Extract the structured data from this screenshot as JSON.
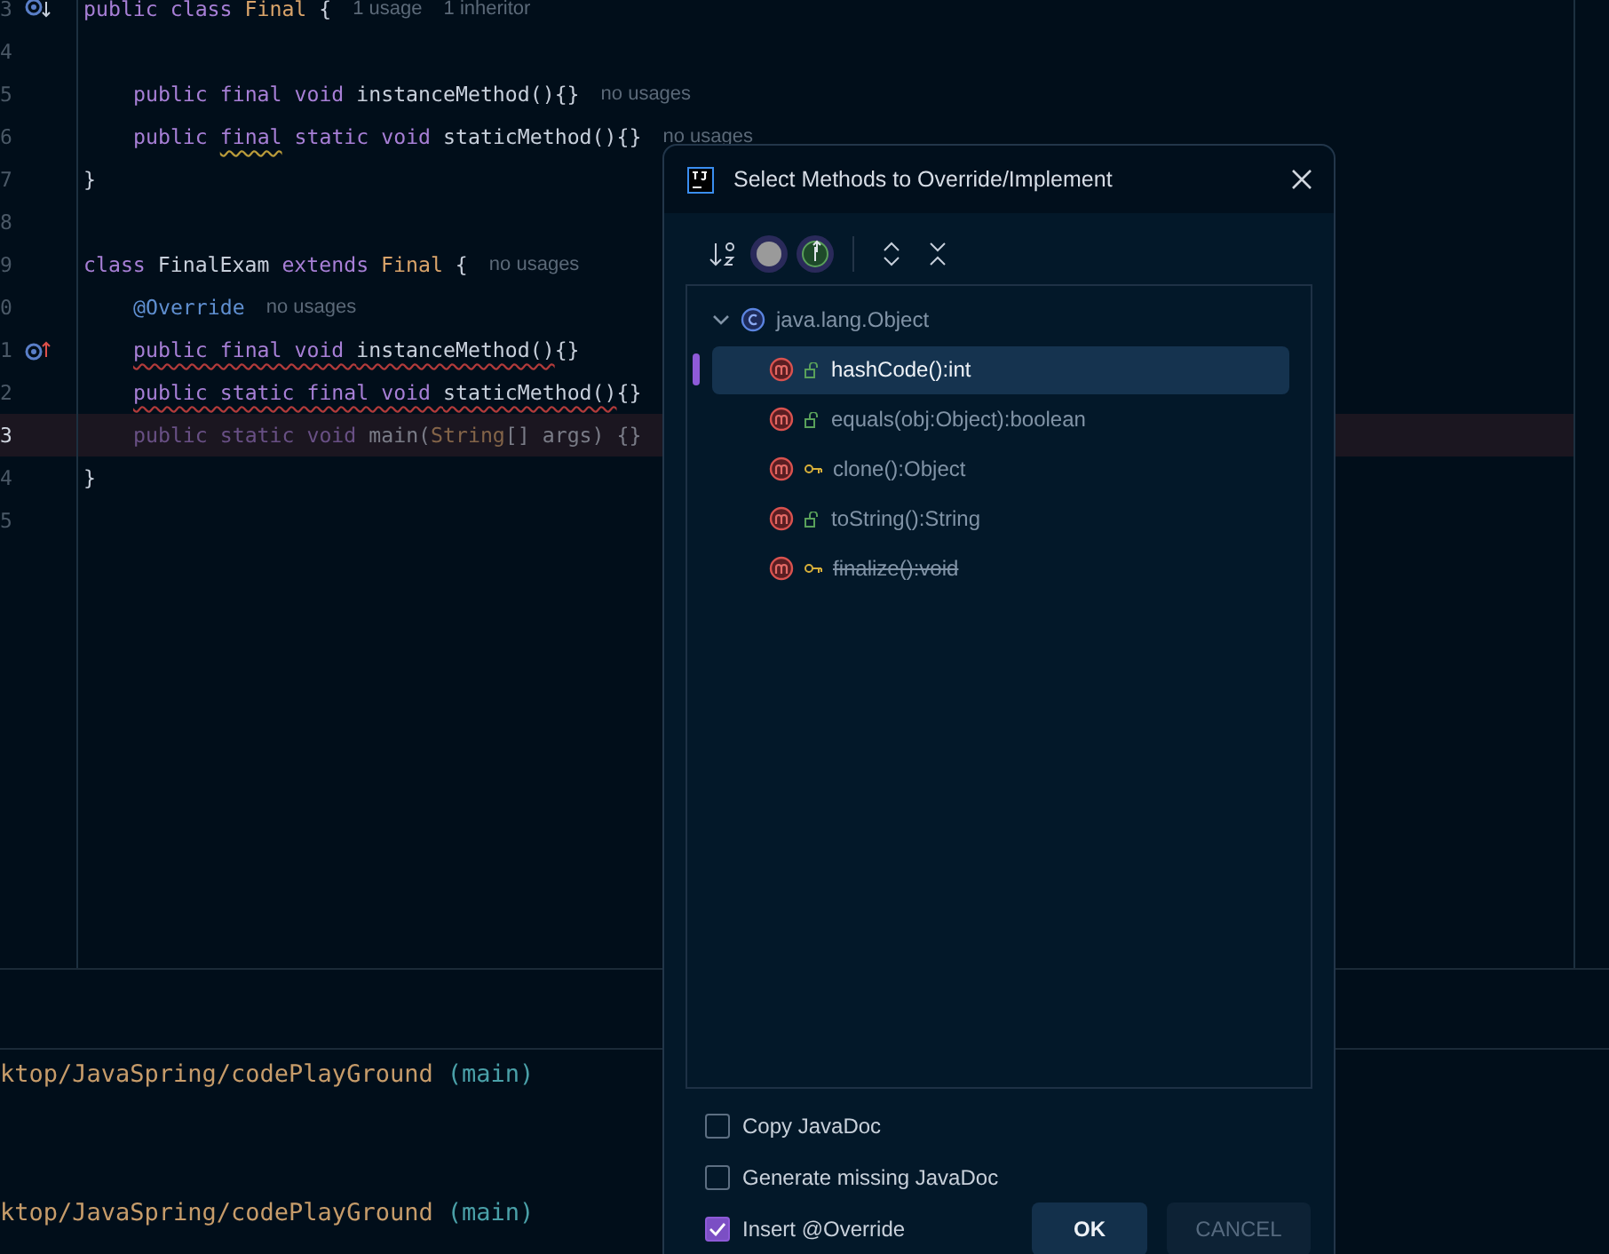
{
  "editor": {
    "lines": [
      {
        "number": "3",
        "marker": {
          "kind": "implemented"
        },
        "current": false,
        "dimmed": false,
        "indented": false,
        "tokens": [
          {
            "text": "public class ",
            "kind": "kw",
            "error": false,
            "warning": false
          },
          {
            "text": "Final",
            "kind": "cls",
            "error": false,
            "warning": false
          },
          {
            "text": " {",
            "kind": "plain",
            "error": false,
            "warning": false
          }
        ],
        "hints": [
          "1 usage",
          "1 inheritor"
        ]
      },
      {
        "number": "4",
        "current": false
      },
      {
        "number": "5",
        "current": false,
        "dimmed": false,
        "indented": true,
        "tokens": [
          {
            "text": "public final void ",
            "kind": "kw",
            "error": false,
            "warning": false
          },
          {
            "text": "instanceMethod(){}",
            "kind": "plain",
            "error": false,
            "warning": false
          }
        ],
        "hints": [
          "no usages"
        ]
      },
      {
        "number": "6",
        "current": false,
        "dimmed": false,
        "indented": true,
        "tokens": [
          {
            "text": "public ",
            "kind": "kw",
            "error": false,
            "warning": false
          },
          {
            "text": "final",
            "kind": "kw",
            "error": false,
            "warning": true
          },
          {
            "text": " static void ",
            "kind": "kw",
            "error": false,
            "warning": false
          },
          {
            "text": "staticMethod(){}",
            "kind": "plain",
            "error": false,
            "warning": false
          }
        ],
        "hints": [
          "no usages"
        ]
      },
      {
        "number": "7",
        "current": false,
        "dimmed": false,
        "indented": false,
        "tokens": [
          {
            "text": "}",
            "kind": "plain",
            "error": false,
            "warning": false
          }
        ]
      },
      {
        "number": "8",
        "current": false
      },
      {
        "number": "9",
        "current": false,
        "dimmed": false,
        "indented": false,
        "tokens": [
          {
            "text": "class ",
            "kind": "kw",
            "error": false,
            "warning": false
          },
          {
            "text": "FinalExam ",
            "kind": "plain",
            "error": false,
            "warning": false
          },
          {
            "text": "extends ",
            "kind": "kw",
            "error": false,
            "warning": false
          },
          {
            "text": "Final",
            "kind": "cls",
            "error": false,
            "warning": false
          },
          {
            "text": " {",
            "kind": "plain",
            "error": false,
            "warning": false
          }
        ],
        "hints": [
          "no usages"
        ]
      },
      {
        "number": "0",
        "current": false,
        "dimmed": false,
        "indented": true,
        "tokens": [
          {
            "text": "@Override",
            "kind": "ann",
            "error": false,
            "warning": false
          }
        ],
        "hints": [
          "no usages"
        ]
      },
      {
        "number": "1",
        "marker": {
          "kind": "overrides"
        },
        "current": false,
        "dimmed": false,
        "indented": true,
        "tokens": [
          {
            "text": "public final void ",
            "kind": "kw",
            "error": true,
            "warning": false
          },
          {
            "text": "instanceMethod()",
            "kind": "plain",
            "error": true,
            "warning": false
          },
          {
            "text": "{}",
            "kind": "plain",
            "error": false,
            "warning": false
          }
        ]
      },
      {
        "number": "2",
        "current": false,
        "dimmed": false,
        "indented": true,
        "tokens": [
          {
            "text": "public static final void ",
            "kind": "kw",
            "error": true,
            "warning": false
          },
          {
            "text": "staticMethod()",
            "kind": "plain",
            "error": true,
            "warning": false
          },
          {
            "text": "{}",
            "kind": "plain",
            "error": false,
            "warning": false
          }
        ]
      },
      {
        "number": "3",
        "current": true,
        "dimmed": true,
        "indented": true,
        "tokens": [
          {
            "text": "public static void ",
            "kind": "kw",
            "error": false,
            "warning": false
          },
          {
            "text": "main(",
            "kind": "plain",
            "error": false,
            "warning": false
          },
          {
            "text": "String",
            "kind": "cls",
            "error": false,
            "warning": false
          },
          {
            "text": "[] args) {}",
            "kind": "plain",
            "error": false,
            "warning": false
          }
        ]
      },
      {
        "number": "4",
        "current": false,
        "dimmed": false,
        "indented": false,
        "tokens": [
          {
            "text": "}",
            "kind": "plain",
            "error": false,
            "warning": false
          }
        ]
      },
      {
        "number": "5",
        "current": false
      }
    ]
  },
  "terminal": {
    "lines": [
      {
        "path": "ktop/JavaSpring/codePlayGround",
        "branch": "(main)"
      },
      {
        "path": "ktop/JavaSpring/codePlayGround",
        "branch": "(main)"
      }
    ]
  },
  "dialog": {
    "title": "Select Methods to Override/Implement",
    "tree": {
      "label": "java.lang.Object",
      "expanded": true,
      "children": [
        {
          "label": "hashCode():int",
          "kind": "public",
          "selected": true,
          "deprecated": false
        },
        {
          "label": "equals(obj:Object):boolean",
          "kind": "public",
          "selected": false,
          "deprecated": false
        },
        {
          "label": "clone():Object",
          "kind": "protected",
          "selected": false,
          "deprecated": false
        },
        {
          "label": "toString():String",
          "kind": "public",
          "selected": false,
          "deprecated": false
        },
        {
          "label": "finalize():void",
          "kind": "protected",
          "selected": false,
          "deprecated": true
        }
      ]
    },
    "options": [
      {
        "label": "Copy JavaDoc",
        "checked": false
      },
      {
        "label": "Generate missing JavaDoc",
        "checked": false
      },
      {
        "label": "Insert @Override",
        "checked": true
      }
    ],
    "buttons": [
      {
        "label": "OK",
        "kind": "primary"
      },
      {
        "label": "CANCEL",
        "kind": "secondary"
      }
    ]
  }
}
